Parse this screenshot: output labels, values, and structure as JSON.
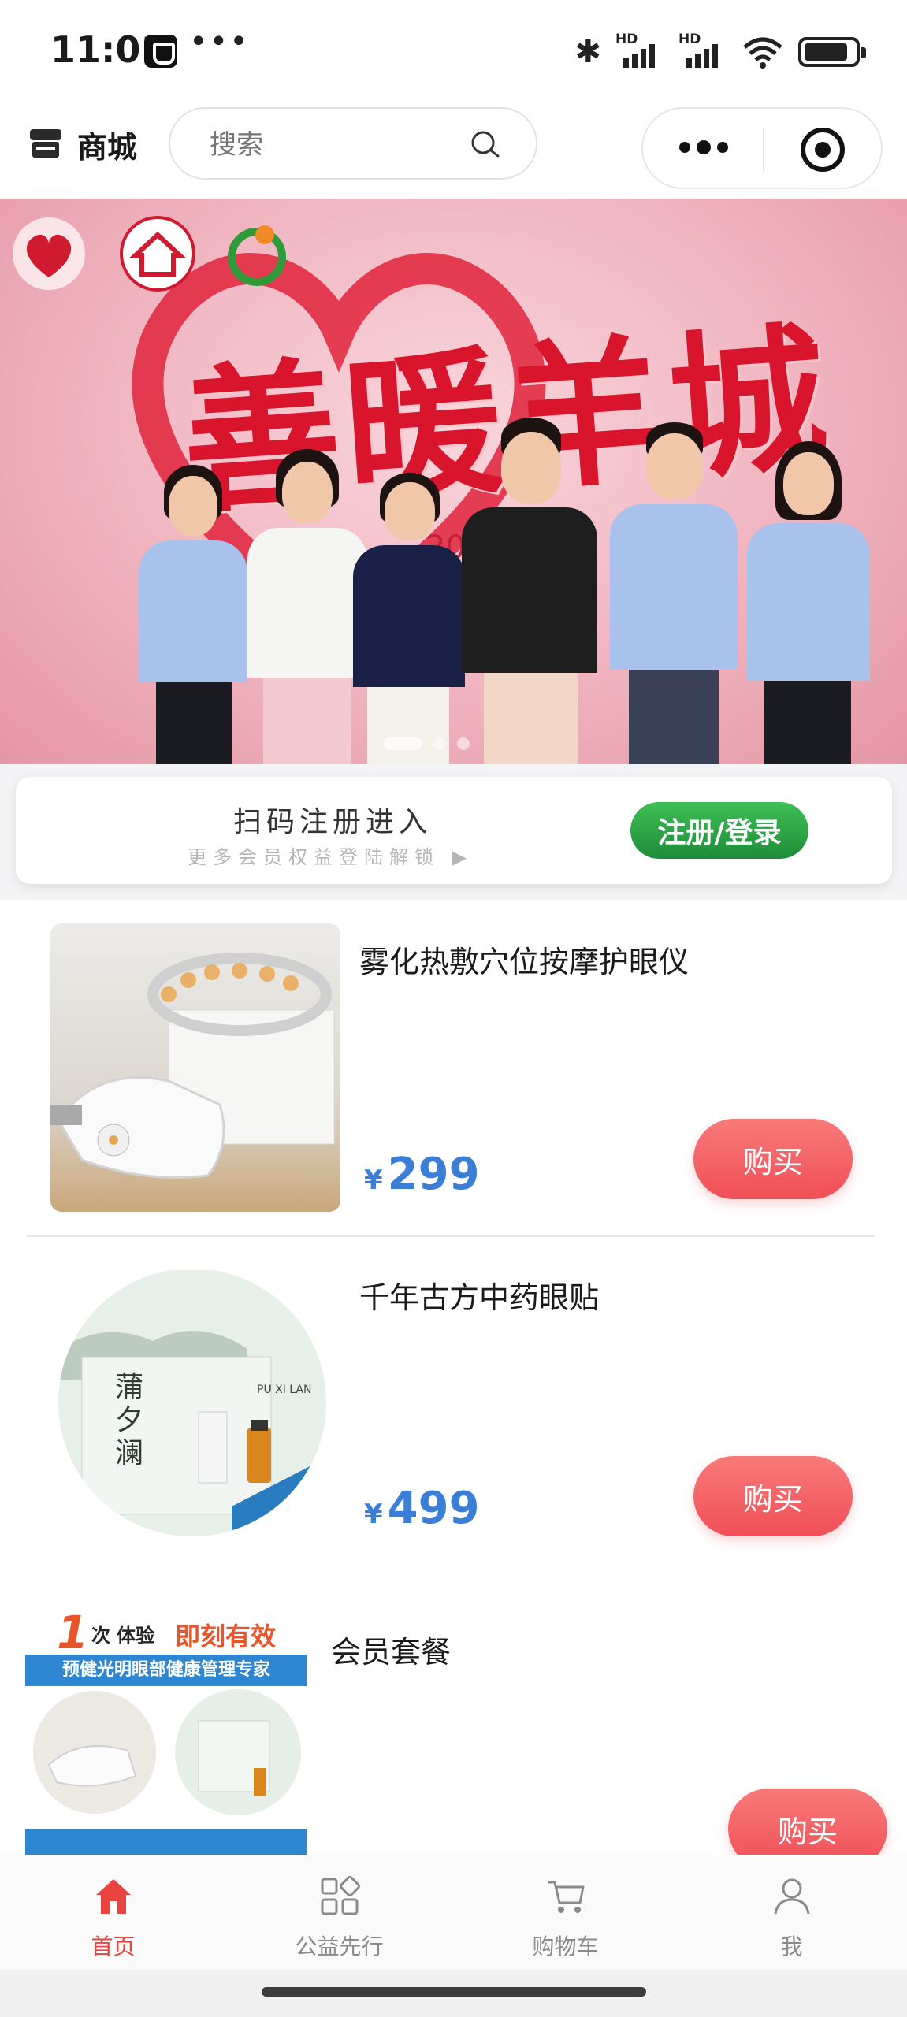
{
  "status_bar": {
    "time": "11:01",
    "more": "•••",
    "icons": [
      "app-notification-icon",
      "bluetooth-icon",
      "signal-hd-icon",
      "signal-hd-icon",
      "wifi-icon",
      "battery-icon"
    ],
    "signal_label": "HD"
  },
  "header": {
    "store_title": "商城",
    "store_icon": "store-icon",
    "search_placeholder": "搜索",
    "search_icon": "search-icon",
    "capsule_icons": [
      "more-dots-icon",
      "target-icon"
    ]
  },
  "banner": {
    "title": "善暖羊城",
    "subtitle_fragment": "—2025年",
    "logos": [
      "海珠慈善 logo",
      "community-house logo",
      "广州青年 logo"
    ],
    "page_indicator": {
      "count": 3,
      "active": 0
    }
  },
  "register": {
    "title": "扫码注册进入",
    "subtitle": "更多会员权益登陆解锁 ▶",
    "button": "注册/登录"
  },
  "products": [
    {
      "name": "雾化热敷穴位按摩护眼仪",
      "currency": "¥",
      "price": "299",
      "buy": "购买"
    },
    {
      "name": "千年古方中药眼贴",
      "currency": "¥",
      "price": "499",
      "buy": "购买"
    },
    {
      "name": "会员套餐",
      "buy": "购买",
      "img_text": {
        "headline_num": "1",
        "headline_unit": "次",
        "headline_word": "体验",
        "headline_right": "即刻有效",
        "band": "预健光明眼部健康管理专家"
      }
    }
  ],
  "product_images": {
    "p2_brand": "蒲夕澜",
    "p2_brand_en": "PU XI LAN"
  },
  "tabs": [
    {
      "label": "首页",
      "icon": "home-icon",
      "active": true
    },
    {
      "label": "公益先行",
      "icon": "grid-icon",
      "active": false
    },
    {
      "label": "购物车",
      "icon": "cart-icon",
      "active": false
    },
    {
      "label": "我",
      "icon": "user-icon",
      "active": false
    }
  ],
  "colors": {
    "accent_red": "#e8433f",
    "price_blue": "#3a7fd5",
    "register_green": "#1e8c39",
    "buy_red": "#f04f57"
  }
}
